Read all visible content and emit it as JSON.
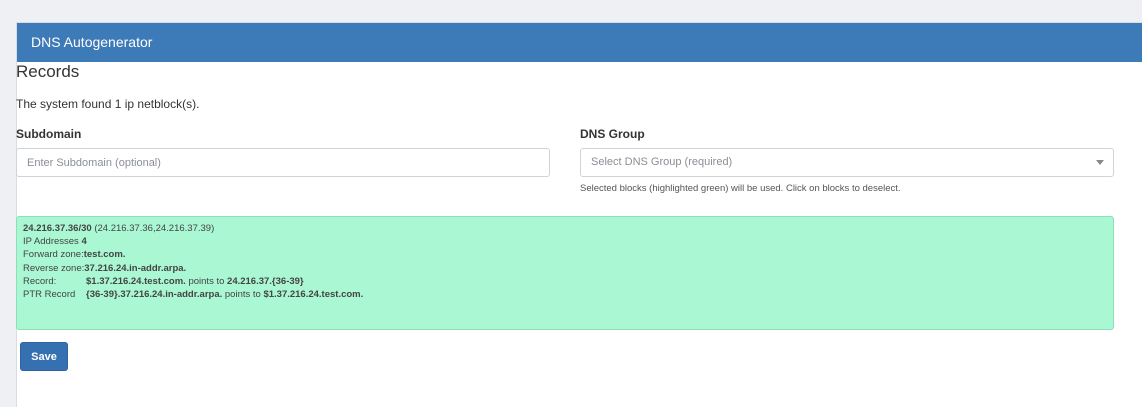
{
  "panel": {
    "title": "DNS Autogenerator"
  },
  "records": {
    "section_title": "Records",
    "found_text": "The system found 1 ip netblock(s)."
  },
  "subdomain": {
    "label": "Subdomain",
    "placeholder": "Enter Subdomain (optional)",
    "value": ""
  },
  "dns_group": {
    "label": "DNS Group",
    "placeholder": "Select DNS Group (required)",
    "help_text": "Selected blocks (highlighted green) will be used. Click on blocks to deselect."
  },
  "block": {
    "netblock": "24.216.37.36/30",
    "range": "(24.216.37.36,24.216.37.39)",
    "ip_label": "IP Addresses",
    "ip_count": "4",
    "forward_label": "Forward zone:",
    "forward_zone": "test.com.",
    "reverse_label": "Reverse zone:",
    "reverse_zone": "37.216.24.in-addr.arpa.",
    "record_label": "Record:",
    "record_name": "$1.37.216.24.test.com.",
    "record_points": " points to ",
    "record_target": "24.216.37.{36-39}",
    "ptr_label": "PTR Record",
    "ptr_name": "{36-39}.37.216.24.in-addr.arpa.",
    "ptr_points": " points to ",
    "ptr_target": "$1.37.216.24.test.com.",
    "highlight_color": "#aaf7d3"
  },
  "actions": {
    "save_label": "Save"
  },
  "colors": {
    "header": "#3d7ab8",
    "primary_button": "#3570b0"
  }
}
